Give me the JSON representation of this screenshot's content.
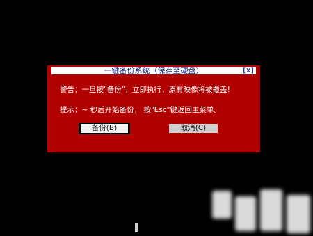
{
  "dialog": {
    "title": "一键备份系统（保存至硬盘）",
    "close_label": "[x]",
    "warning": "警告：一旦按\"备份\"，立即执行，原有映像将被覆盖!",
    "hint": "提示：~   秒后开始备份，  按\"Esc\"键返回主菜单。",
    "backup_button": "备份(B)",
    "cancel_button": "取消(C)"
  },
  "colors": {
    "dialog_background": "#b00000",
    "title_text": "#1c2f8a",
    "page_background": "#000000"
  }
}
